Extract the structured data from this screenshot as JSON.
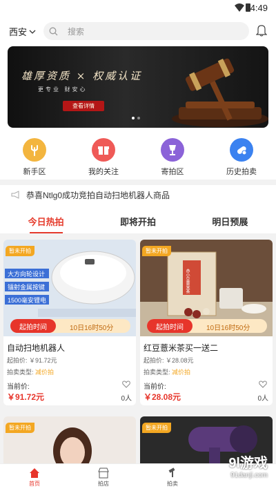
{
  "status": {
    "time": "4:49"
  },
  "header": {
    "city": "西安",
    "search_placeholder": "搜索"
  },
  "banner": {
    "title": "雄厚资质 × 权威认证",
    "subtitle": "更专业  财安心",
    "button": "查看详情"
  },
  "categories": [
    {
      "label": "新手区",
      "icon": "hand-icon",
      "color": "#f3b53f"
    },
    {
      "label": "我的关注",
      "icon": "gift-icon",
      "color": "#ef5a57"
    },
    {
      "label": "寄拍区",
      "icon": "cup-icon",
      "color": "#8b63d8"
    },
    {
      "label": "历史拍卖",
      "icon": "pill-icon",
      "color": "#3b82f0"
    }
  ],
  "notice": {
    "text": "恭喜Ntlg0成功竞拍自动扫地机器人商品"
  },
  "tabs": [
    "今日热拍",
    "即将开拍",
    "明日预展"
  ],
  "products": [
    {
      "tag": "暂未开拍",
      "start_label": "起拍时间",
      "start_time": "10日16时50分",
      "name": "自动扫地机器人",
      "start_price": "起拍价: ￥91.72元",
      "type_label": "拍卖类型:",
      "type_value": "减价拍",
      "current_label": "当前价:",
      "current_price": "￥91.72元",
      "count": "0人"
    },
    {
      "tag": "暂未开拍",
      "start_label": "起拍时间",
      "start_time": "10日16时50分",
      "name": "红豆薏米茶买一送二",
      "start_price": "起拍价: ￥28.08元",
      "type_label": "拍卖类型:",
      "type_value": "减价拍",
      "current_label": "当前价:",
      "current_price": "￥28.08元",
      "count": "0人"
    },
    {
      "tag": "暂未开拍"
    },
    {
      "tag": "暂未开拍"
    }
  ],
  "product_image_text": {
    "robot": [
      "大方向轮设计",
      "镭射金属按键",
      "1500毫安锂电"
    ],
    "tea": "赤小豆薏米茶"
  },
  "nav": [
    {
      "label": "首页",
      "icon": "home-icon"
    },
    {
      "label": "拍店",
      "icon": "shop-icon"
    },
    {
      "label": "拍卖",
      "icon": "gavel-icon"
    }
  ],
  "watermark": {
    "main": "9l游戏",
    "sub": "91danji.com"
  }
}
